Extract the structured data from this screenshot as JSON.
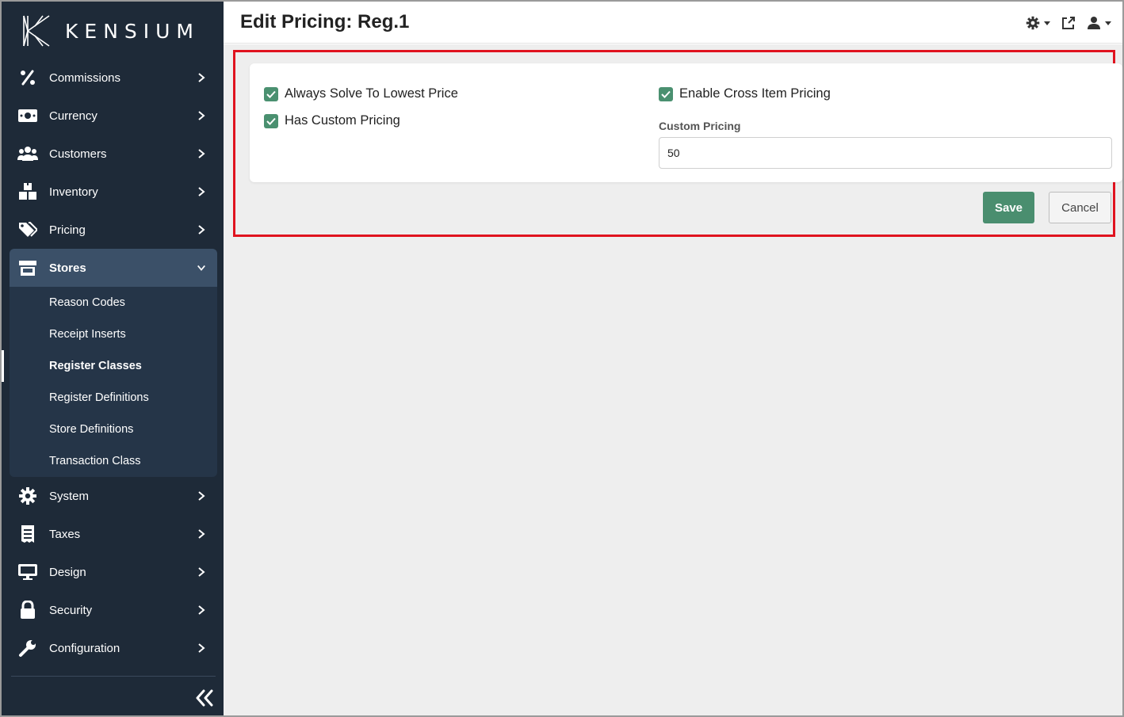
{
  "brand": {
    "name": "KENSIUM"
  },
  "sidebar": {
    "items": [
      {
        "label": "Commissions",
        "icon": "percent-icon"
      },
      {
        "label": "Currency",
        "icon": "money-bill-icon"
      },
      {
        "label": "Customers",
        "icon": "users-icon"
      },
      {
        "label": "Inventory",
        "icon": "boxes-icon"
      },
      {
        "label": "Pricing",
        "icon": "tags-icon"
      },
      {
        "label": "Stores",
        "icon": "store-icon",
        "expanded": true
      }
    ],
    "stores_submenu": [
      {
        "label": "Reason Codes"
      },
      {
        "label": "Receipt Inserts"
      },
      {
        "label": "Register Classes",
        "current": true
      },
      {
        "label": "Register Definitions"
      },
      {
        "label": "Store Definitions"
      },
      {
        "label": "Transaction Class"
      }
    ],
    "items_after": [
      {
        "label": "System",
        "icon": "gear-icon"
      },
      {
        "label": "Taxes",
        "icon": "receipt-icon"
      },
      {
        "label": "Design",
        "icon": "monitor-icon"
      },
      {
        "label": "Security",
        "icon": "lock-icon"
      },
      {
        "label": "Configuration",
        "icon": "wrench-icon"
      }
    ]
  },
  "header": {
    "title": "Edit Pricing: Reg.1",
    "tools": [
      "settings-icon",
      "external-link-icon",
      "user-icon"
    ]
  },
  "form": {
    "always_solve_lowest": {
      "label": "Always Solve To Lowest Price",
      "checked": true
    },
    "has_custom_pricing": {
      "label": "Has Custom Pricing",
      "checked": true
    },
    "enable_cross_item": {
      "label": "Enable Cross Item Pricing",
      "checked": true
    },
    "custom_pricing": {
      "label": "Custom Pricing",
      "value": "50"
    }
  },
  "actions": {
    "save_label": "Save",
    "cancel_label": "Cancel"
  },
  "colors": {
    "sidebar_bg": "#1e2a38",
    "active_item_bg": "#3b5068",
    "accent_green": "#4a8e6f",
    "highlight_red": "#e0131f"
  }
}
